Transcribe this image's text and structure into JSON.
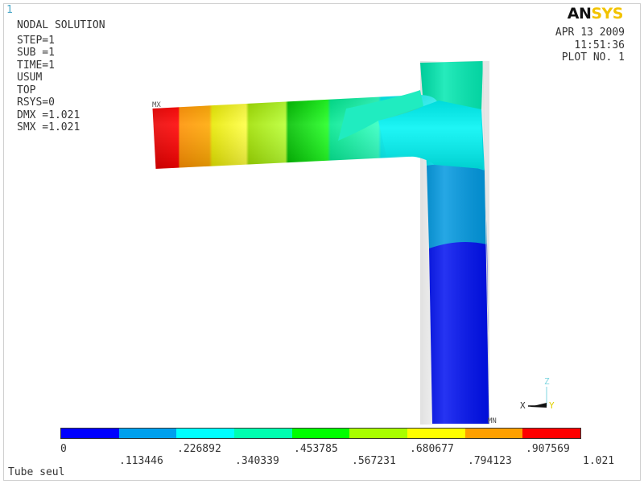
{
  "window_number": "1",
  "header": {
    "title": "NODAL SOLUTION",
    "info_lines": [
      "STEP=1",
      "SUB =1",
      "TIME=1",
      "USUM",
      "TOP",
      "RSYS=0",
      "DMX =1.021",
      "SMX =1.021"
    ]
  },
  "date_block": {
    "date": "APR 13 2009",
    "time": "11:51:36",
    "plot": "PLOT NO.   1"
  },
  "logo": {
    "part_a": "AN",
    "part_b": "SYS",
    "color_a": "#111111",
    "color_b": "#f2c300"
  },
  "markers": {
    "max": "MX",
    "min": "MN"
  },
  "triad": {
    "z": "Z",
    "x": "X",
    "y": "Y"
  },
  "legend": {
    "colors": [
      "#0000ff",
      "#00a0ee",
      "#00ffff",
      "#00ffb0",
      "#00ff00",
      "#a8ff00",
      "#ffff00",
      "#ffa000",
      "#ff0000"
    ],
    "labels_top": [
      "0",
      ".226892",
      ".453785",
      ".680677",
      ".907569"
    ],
    "labels_bottom": [
      ".113446",
      ".340339",
      ".567231",
      ".794123",
      "1.021"
    ]
  },
  "footer": {
    "caption": "Tube seul"
  }
}
